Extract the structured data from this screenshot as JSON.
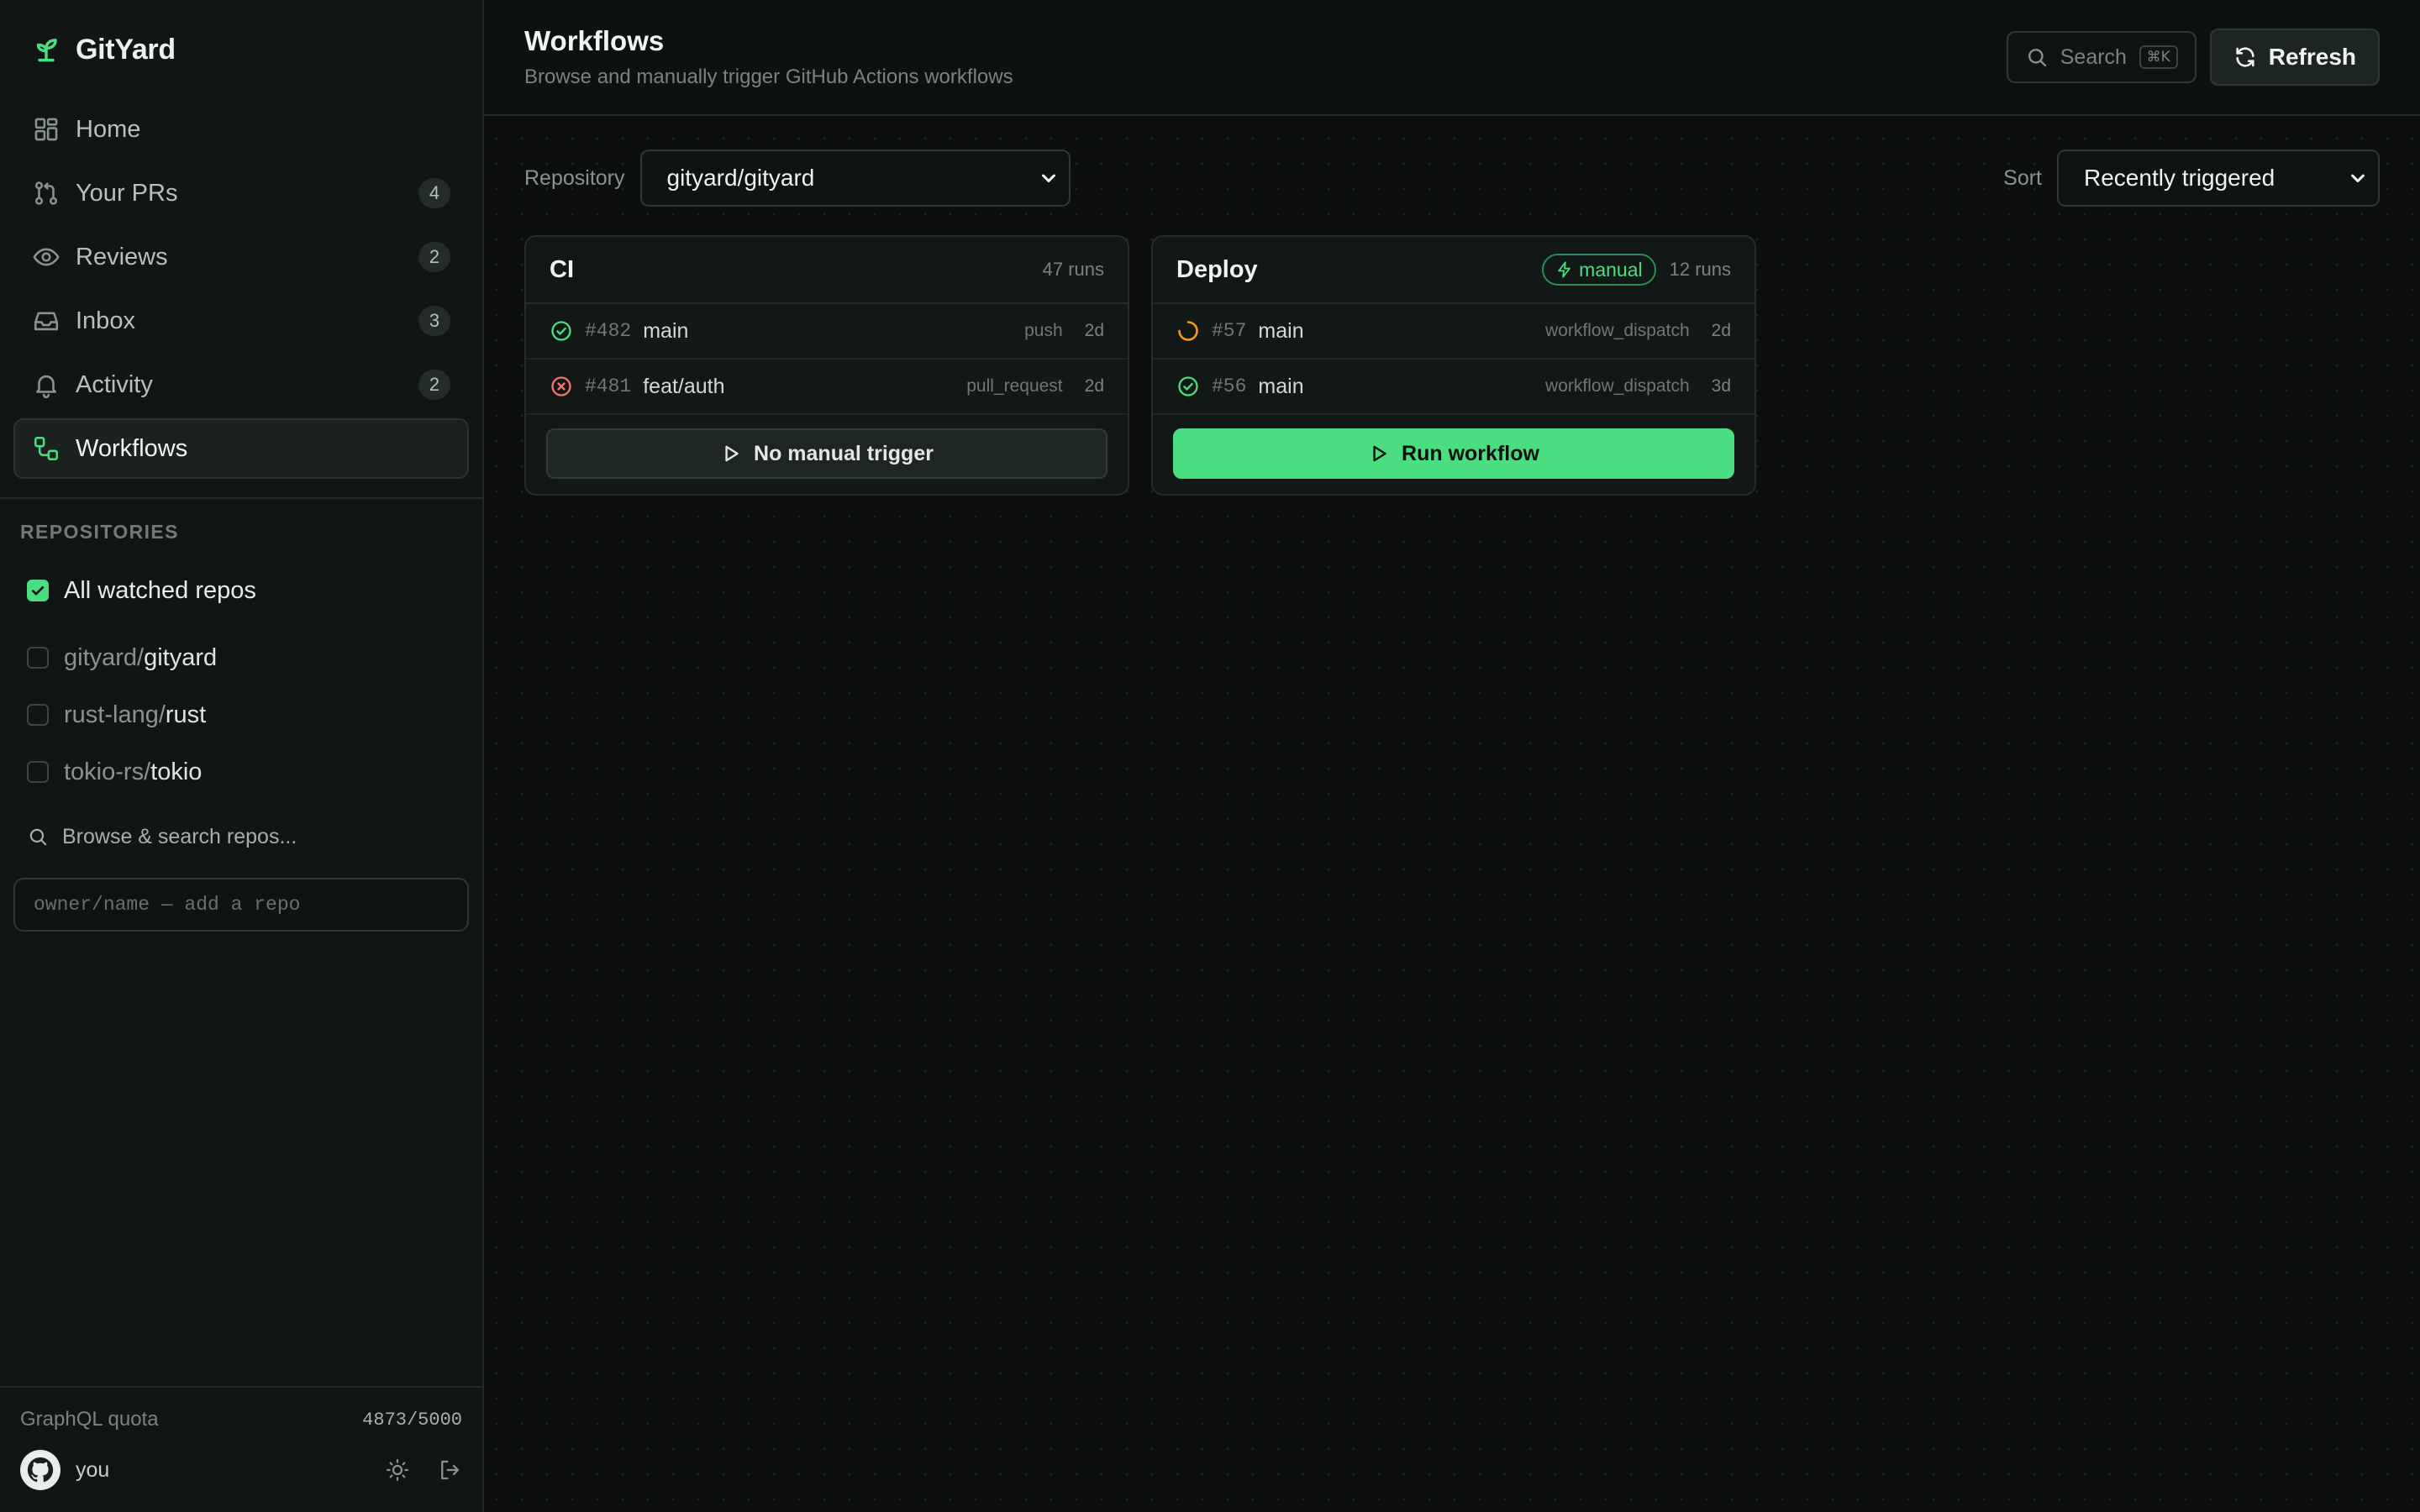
{
  "app": {
    "name": "GitYard"
  },
  "nav": [
    {
      "label": "Home",
      "count": ""
    },
    {
      "label": "Your PRs",
      "count": "4"
    },
    {
      "label": "Reviews",
      "count": "2"
    },
    {
      "label": "Inbox",
      "count": "3"
    },
    {
      "label": "Activity",
      "count": "2"
    },
    {
      "label": "Workflows",
      "count": "",
      "active": true
    }
  ],
  "repositories": {
    "title": "REPOSITORIES",
    "all_label": "All watched repos",
    "items": [
      {
        "owner": "gityard/",
        "name": "gityard"
      },
      {
        "owner": "rust-lang/",
        "name": "rust"
      },
      {
        "owner": "tokio-rs/",
        "name": "tokio"
      }
    ],
    "browse_label": "Browse & search repos...",
    "add_placeholder": "owner/name — add a repo"
  },
  "footer": {
    "quota_label": "GraphQL quota",
    "quota_value": "4873/5000",
    "user": "you"
  },
  "header": {
    "title": "Workflows",
    "subtitle": "Browse and manually trigger GitHub Actions workflows",
    "search_label": "Search",
    "search_shortcut": "⌘K",
    "refresh_label": "Refresh"
  },
  "filters": {
    "repo_label": "Repository",
    "repo_value": "gityard/gityard",
    "sort_label": "Sort",
    "sort_value": "Recently triggered"
  },
  "workflows": [
    {
      "name": "CI",
      "badge": "",
      "runs": "47 runs",
      "items": [
        {
          "status": "success",
          "num": "#482",
          "branch": "main",
          "event": "push",
          "age": "2d"
        },
        {
          "status": "failure",
          "num": "#481",
          "branch": "feat/auth",
          "event": "pull_request",
          "age": "2d"
        }
      ],
      "action": "No manual trigger"
    },
    {
      "name": "Deploy",
      "badge": "manual",
      "runs": "12 runs",
      "items": [
        {
          "status": "running",
          "num": "#57",
          "branch": "main",
          "event": "workflow_dispatch",
          "age": "2d"
        },
        {
          "status": "success",
          "num": "#56",
          "branch": "main",
          "event": "workflow_dispatch",
          "age": "3d"
        }
      ],
      "action": "Run workflow"
    }
  ],
  "colors": {
    "accent": "#4ade80",
    "success": "#4ade80",
    "failure": "#f87171",
    "running": "#f59e0b",
    "background": "#0c0f0e"
  }
}
